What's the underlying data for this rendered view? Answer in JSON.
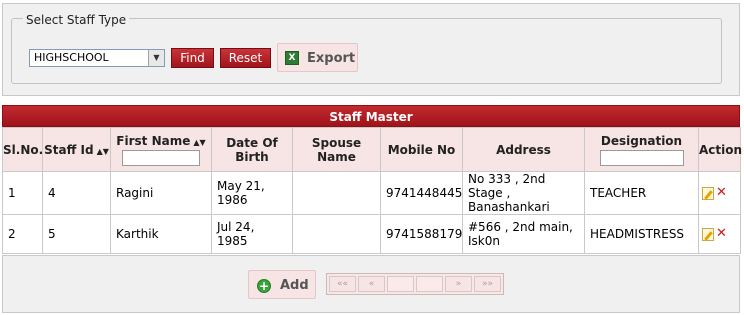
{
  "filter": {
    "legend": "Select Staff Type",
    "staff_type_value": "HIGHSCHOOL",
    "find_label": "Find",
    "reset_label": "Reset",
    "export_label": "Export"
  },
  "grid": {
    "caption": "Staff Master",
    "columns": {
      "sl_no": "Sl.No.",
      "staff_id": "Staff Id",
      "first_name": "First Name",
      "dob": "Date Of Birth",
      "spouse": "Spouse Name",
      "mobile": "Mobile No",
      "address": "Address",
      "designation": "Designation",
      "action": "Action"
    },
    "rows": [
      {
        "sl_no": "1",
        "staff_id": "4",
        "first_name": "Ragini",
        "dob": "May 21, 1986",
        "spouse": "",
        "mobile": "9741448445",
        "address": "No 333 , 2nd Stage , Banashankari",
        "designation": "TEACHER"
      },
      {
        "sl_no": "2",
        "staff_id": "5",
        "first_name": "Karthik",
        "dob": "Jul 24, 1985",
        "spouse": "",
        "mobile": "9741588179",
        "address": "#566 , 2nd main, Isk0n",
        "designation": "HEADMISTRESS"
      }
    ]
  },
  "footer": {
    "add_label": "Add",
    "pager": {
      "first": "««",
      "prev": "«",
      "next": "»",
      "last": "»»"
    }
  },
  "icons": {
    "sort": "sort-icon",
    "edit": "edit-icon",
    "delete": "delete-icon",
    "export": "excel-icon",
    "add": "add-icon"
  },
  "colors": {
    "header_red": "#b01e24",
    "button_pink": "#f7e4e4",
    "panel_gray": "#f0f0f0"
  }
}
